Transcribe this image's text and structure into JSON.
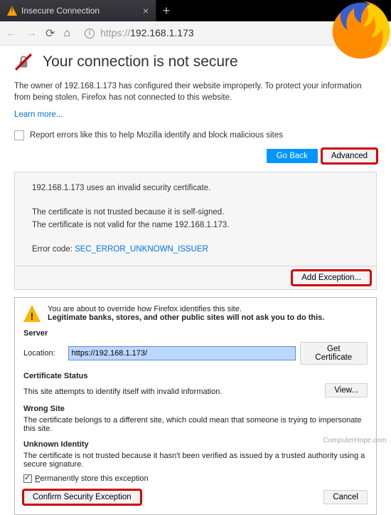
{
  "tab": {
    "title": "Insecure Connection"
  },
  "url": {
    "scheme": "https://",
    "host": "192.168.1.173"
  },
  "heading": "Your connection is not secure",
  "intro": "The owner of 192.168.1.173 has configured their website improperly. To protect your information from being stolen, Firefox has not connected to this website.",
  "learn_more": "Learn more...",
  "report_chk": "Report errors like this to help Mozilla identify and block malicious sites",
  "buttons": {
    "goback": "Go Back",
    "advanced": "Advanced",
    "add_exception": "Add Exception...",
    "get_cert": "Get Certificate",
    "view": "View...",
    "confirm": "Confirm Security Exception",
    "cancel": "Cancel"
  },
  "certmsg": {
    "line1": "192.168.1.173 uses an invalid security certificate.",
    "line2": "The certificate is not trusted because it is self-signed.",
    "line3": "The certificate is not valid for the name 192.168.1.173.",
    "err_label": "Error code: ",
    "err_code": "SEC_ERROR_UNKNOWN_ISSUER"
  },
  "dialog": {
    "about": "You are about to override how Firefox identifies this site.",
    "warn": "Legitimate banks, stores, and other public sites will not ask you to do this.",
    "server": "Server",
    "location_label": "Location:",
    "location_value": "https://192.168.1.173/",
    "cert_status": "Certificate Status",
    "cert_status_msg": "This site attempts to identify itself with invalid information.",
    "wrong_site": "Wrong Site",
    "wrong_site_msg": "The certificate belongs to a different site, which could mean that someone is trying to impersonate this site.",
    "unknown": "Unknown Identity",
    "unknown_msg": "The certificate is not trusted because it hasn't been verified as issued by a trusted authority using a secure signature.",
    "perm_store_pre": "P",
    "perm_store_post": "ermanently store this exception"
  },
  "watermark": "ComputerHope.com"
}
